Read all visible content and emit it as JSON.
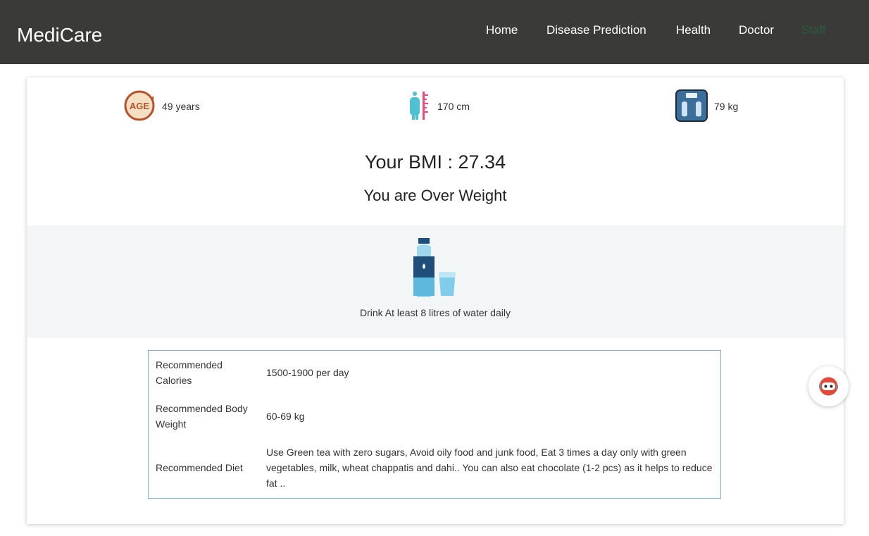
{
  "header": {
    "brand": "MediCare",
    "nav": [
      {
        "label": "Home"
      },
      {
        "label": "Disease Prediction"
      },
      {
        "label": "Health"
      },
      {
        "label": "Doctor"
      },
      {
        "label": "Staff"
      }
    ]
  },
  "stats": {
    "age": "49 years",
    "height": "170 cm",
    "weight": "79 kg",
    "age_icon_text": "AGE"
  },
  "bmi": {
    "text": "Your BMI : 27.34",
    "category": "You are Over Weight"
  },
  "water": {
    "text": "Drink At least 8 litres of water daily"
  },
  "recommendations": [
    {
      "label": "Recommended Calories",
      "value": "1500-1900 per day"
    },
    {
      "label": "Recommended Body Weight",
      "value": "60-69 kg"
    },
    {
      "label": "Recommended Diet",
      "value": "Use Green tea with zero sugars, Avoid oily food and junk food, Eat 3 times a day only with green vegetables, milk, wheat chappatis and dahi.. You can also eat chocolate (1-2 pcs) as it helps to reduce fat .."
    }
  ],
  "colors": {
    "navbar": "#3a3a38",
    "active_nav": "#2e5a3f",
    "table_border": "#7fb2cf",
    "band": "#f3f6f7"
  }
}
